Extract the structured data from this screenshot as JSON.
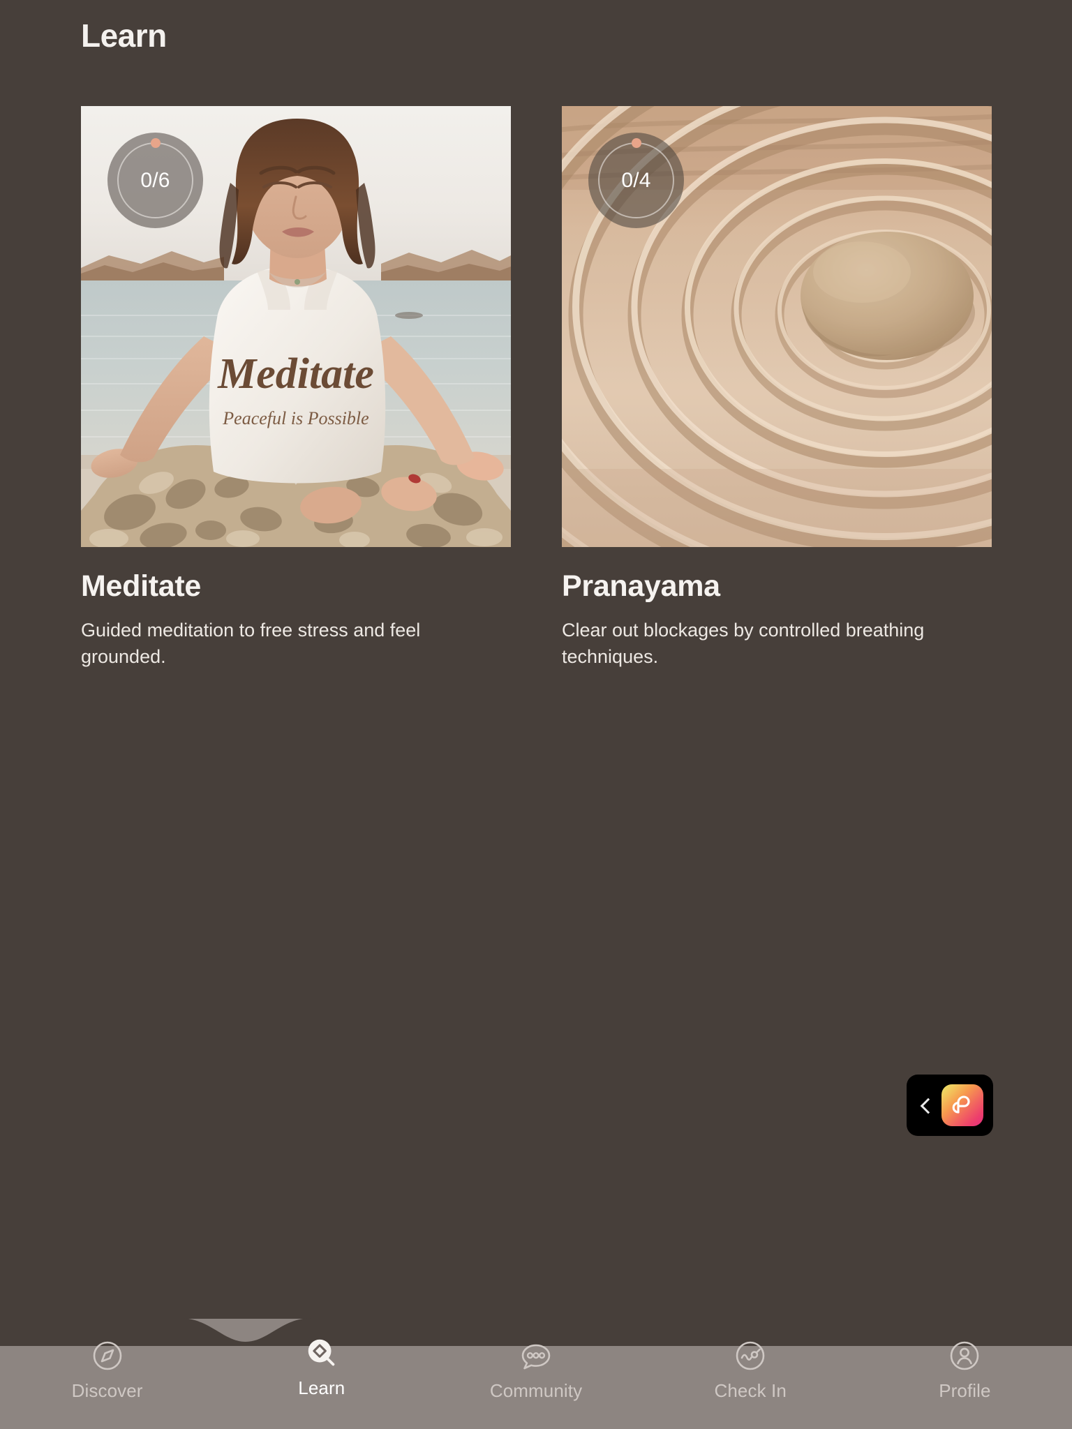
{
  "theme": {
    "background": "#473F3A",
    "nav_background": "#8D8581",
    "text_primary": "#F6F3F0",
    "text_muted": "#CFC8C4",
    "accent_dot": "#E8A58A",
    "pill_background": "#000000"
  },
  "header": {
    "title": "Learn"
  },
  "cards": [
    {
      "id": "meditate",
      "title": "Meditate",
      "description": "Guided meditation to free stress and feel grounded.",
      "progress_label": "0/6",
      "progress_completed": 0,
      "progress_total": 6,
      "image_alt": "Woman meditating in lotus pose by the water wearing a white Meditate tank top",
      "image_shirt_text_primary": "Meditate",
      "image_shirt_text_secondary": "Peaceful is Possible"
    },
    {
      "id": "pranayama",
      "title": "Pranayama",
      "description": "Clear out blockages by controlled breathing techniques.",
      "progress_label": "0/4",
      "progress_completed": 0,
      "progress_total": 4,
      "image_alt": "Zen garden with raked concentric sand rings around a smooth stone"
    }
  ],
  "app_switcher": {
    "back_icon": "chevron-left-icon",
    "app_icon": "photos-app-icon"
  },
  "bottom_nav": {
    "active_index": 1,
    "items": [
      {
        "label": "Discover",
        "icon": "compass-icon",
        "active": false
      },
      {
        "label": "Learn",
        "icon": "search-diamond-icon",
        "active": true
      },
      {
        "label": "Community",
        "icon": "chat-bubble-icon",
        "active": false
      },
      {
        "label": "Check In",
        "icon": "trend-circle-icon",
        "active": false
      },
      {
        "label": "Profile",
        "icon": "person-circle-icon",
        "active": false
      }
    ]
  }
}
